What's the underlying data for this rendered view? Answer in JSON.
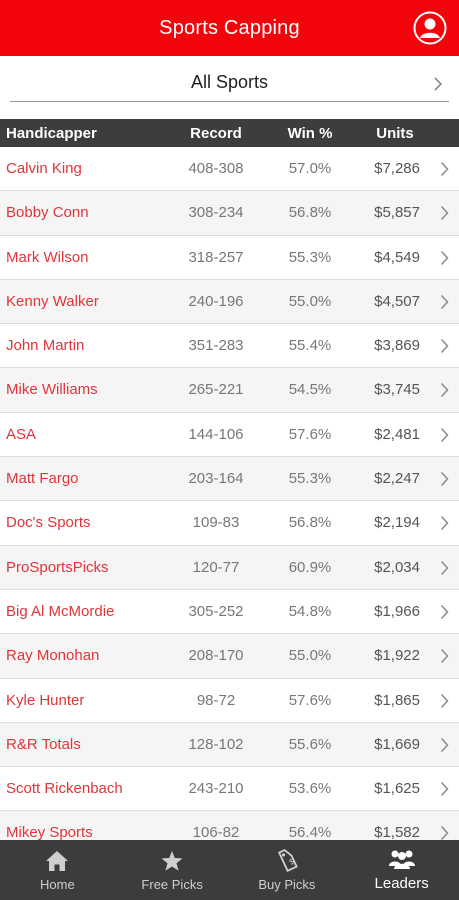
{
  "header": {
    "title": "Sports Capping"
  },
  "filter": {
    "label": "All Sports"
  },
  "table": {
    "columns": [
      "Handicapper",
      "Record",
      "Win %",
      "Units"
    ],
    "rows": [
      {
        "name": "Calvin King",
        "record": "408-308",
        "win": "57.0%",
        "units": "$7,286"
      },
      {
        "name": "Bobby Conn",
        "record": "308-234",
        "win": "56.8%",
        "units": "$5,857"
      },
      {
        "name": "Mark Wilson",
        "record": "318-257",
        "win": "55.3%",
        "units": "$4,549"
      },
      {
        "name": "Kenny Walker",
        "record": "240-196",
        "win": "55.0%",
        "units": "$4,507"
      },
      {
        "name": "John Martin",
        "record": "351-283",
        "win": "55.4%",
        "units": "$3,869"
      },
      {
        "name": "Mike Williams",
        "record": "265-221",
        "win": "54.5%",
        "units": "$3,745"
      },
      {
        "name": "ASA",
        "record": "144-106",
        "win": "57.6%",
        "units": "$2,481"
      },
      {
        "name": "Matt Fargo",
        "record": "203-164",
        "win": "55.3%",
        "units": "$2,247"
      },
      {
        "name": "Doc's Sports",
        "record": "109-83",
        "win": "56.8%",
        "units": "$2,194"
      },
      {
        "name": "ProSportsPicks",
        "record": "120-77",
        "win": "60.9%",
        "units": "$2,034"
      },
      {
        "name": "Big Al McMordie",
        "record": "305-252",
        "win": "54.8%",
        "units": "$1,966"
      },
      {
        "name": "Ray Monohan",
        "record": "208-170",
        "win": "55.0%",
        "units": "$1,922"
      },
      {
        "name": "Kyle Hunter",
        "record": "98-72",
        "win": "57.6%",
        "units": "$1,865"
      },
      {
        "name": "R&R Totals",
        "record": "128-102",
        "win": "55.6%",
        "units": "$1,669"
      },
      {
        "name": "Scott Rickenbach",
        "record": "243-210",
        "win": "53.6%",
        "units": "$1,625"
      },
      {
        "name": "Mikey Sports",
        "record": "106-82",
        "win": "56.4%",
        "units": "$1,582"
      }
    ]
  },
  "tabs": [
    {
      "label": "Home",
      "icon": "home-icon",
      "active": false
    },
    {
      "label": "Free Picks",
      "icon": "star-icon",
      "active": false
    },
    {
      "label": "Buy Picks",
      "icon": "tag-icon",
      "active": false
    },
    {
      "label": "Leaders",
      "icon": "group-icon",
      "active": true
    }
  ],
  "colors": {
    "brand": "#f2040b",
    "name_text": "#e0353b",
    "header_bg": "#3d3d3d",
    "tabbar_bg": "#3c3c3c"
  }
}
